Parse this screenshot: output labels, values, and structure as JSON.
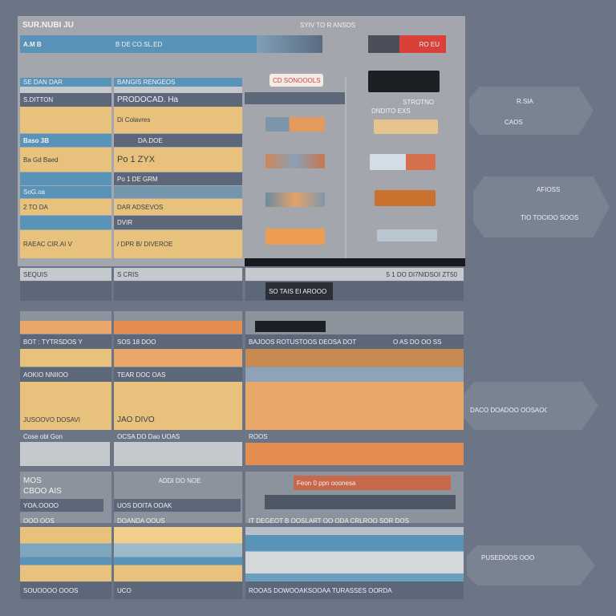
{
  "header": {
    "title": "SUR.NUBI JU",
    "subtitle": "SYIV TO R ANSOS"
  },
  "top_bar": {
    "label": "A.M B",
    "text": "B DE CO.SL.ED",
    "badge": "RO EU"
  },
  "top_panel": {
    "col1": [
      "SE DAN DAR",
      "S.DITTON",
      "Baso 3B",
      "Ba Gd Baed",
      "SoG.oa",
      "2 TO DA",
      "RAEAC CIR.AI V"
    ],
    "col2": [
      "BANGIS RENGEOS",
      "PRODOCAD. Ha",
      "Di Colavres",
      "DA.DOE",
      "Po 1 ZYX",
      "Po 1 DE GRM",
      "DAR ADSEVOS",
      "DVIR",
      "/ DPR B/ DIVEROE"
    ],
    "tag": "CD SONOOOLS",
    "right_caption": "DNDITO EXS",
    "right_label": "STROTNO"
  },
  "bottom": {
    "row1": [
      "SEQUIS",
      "S CRIS",
      "5 1 DO DI7NIDSOI ZT50",
      "SO TAIS EI AROOO"
    ],
    "row2": [
      "BOT : TYTRSDOS Y",
      "SOS 18 DOO",
      "BAJOOS ROTUSTOOS DEOSA  DOT",
      "O AS DO OO SS"
    ],
    "row3": [
      "AOKIO NNIIOO",
      "TEAR DOC OAS"
    ],
    "row4": [
      "JUSOOVO DOSAVI",
      "JAO DIVO"
    ],
    "row5": [
      "Cose obl Gon",
      "OCSA DO Dao UOAS",
      "ROOS"
    ],
    "row6": [
      "MOS",
      "CBOO AIS",
      "YOA.OOOO",
      "ADDI DO NOE",
      "UOS DOITA OOAK",
      "Feon 0 ppn ooonesa"
    ],
    "row7": [
      "OOO OOS",
      "DOANDA OOUS",
      "IT DEGEOT B OOSLART OO ODA  CRLROO SOR DOS"
    ],
    "row8": [
      "SOUOOOO OOOS",
      "UCO",
      "ROOAS DOWOOAKSOOAA TURASSES OORDA"
    ]
  },
  "side": {
    "panel1_title": "R.SIA",
    "panel1_text": "CAOS",
    "panel2_title": "AFIOSS",
    "panel2_text": "TIO TOCIOO SOOS",
    "panel3_text": "DACO DOADOO OOSAOOS",
    "panel4_text": "PUSEDOOS OOO"
  },
  "colors": {
    "background": "#6b7585",
    "yellow": "#e8c27c",
    "blue": "#5a93b8",
    "slate": "#5c6879",
    "orange": "#e38d52",
    "red": "#d9403a"
  }
}
